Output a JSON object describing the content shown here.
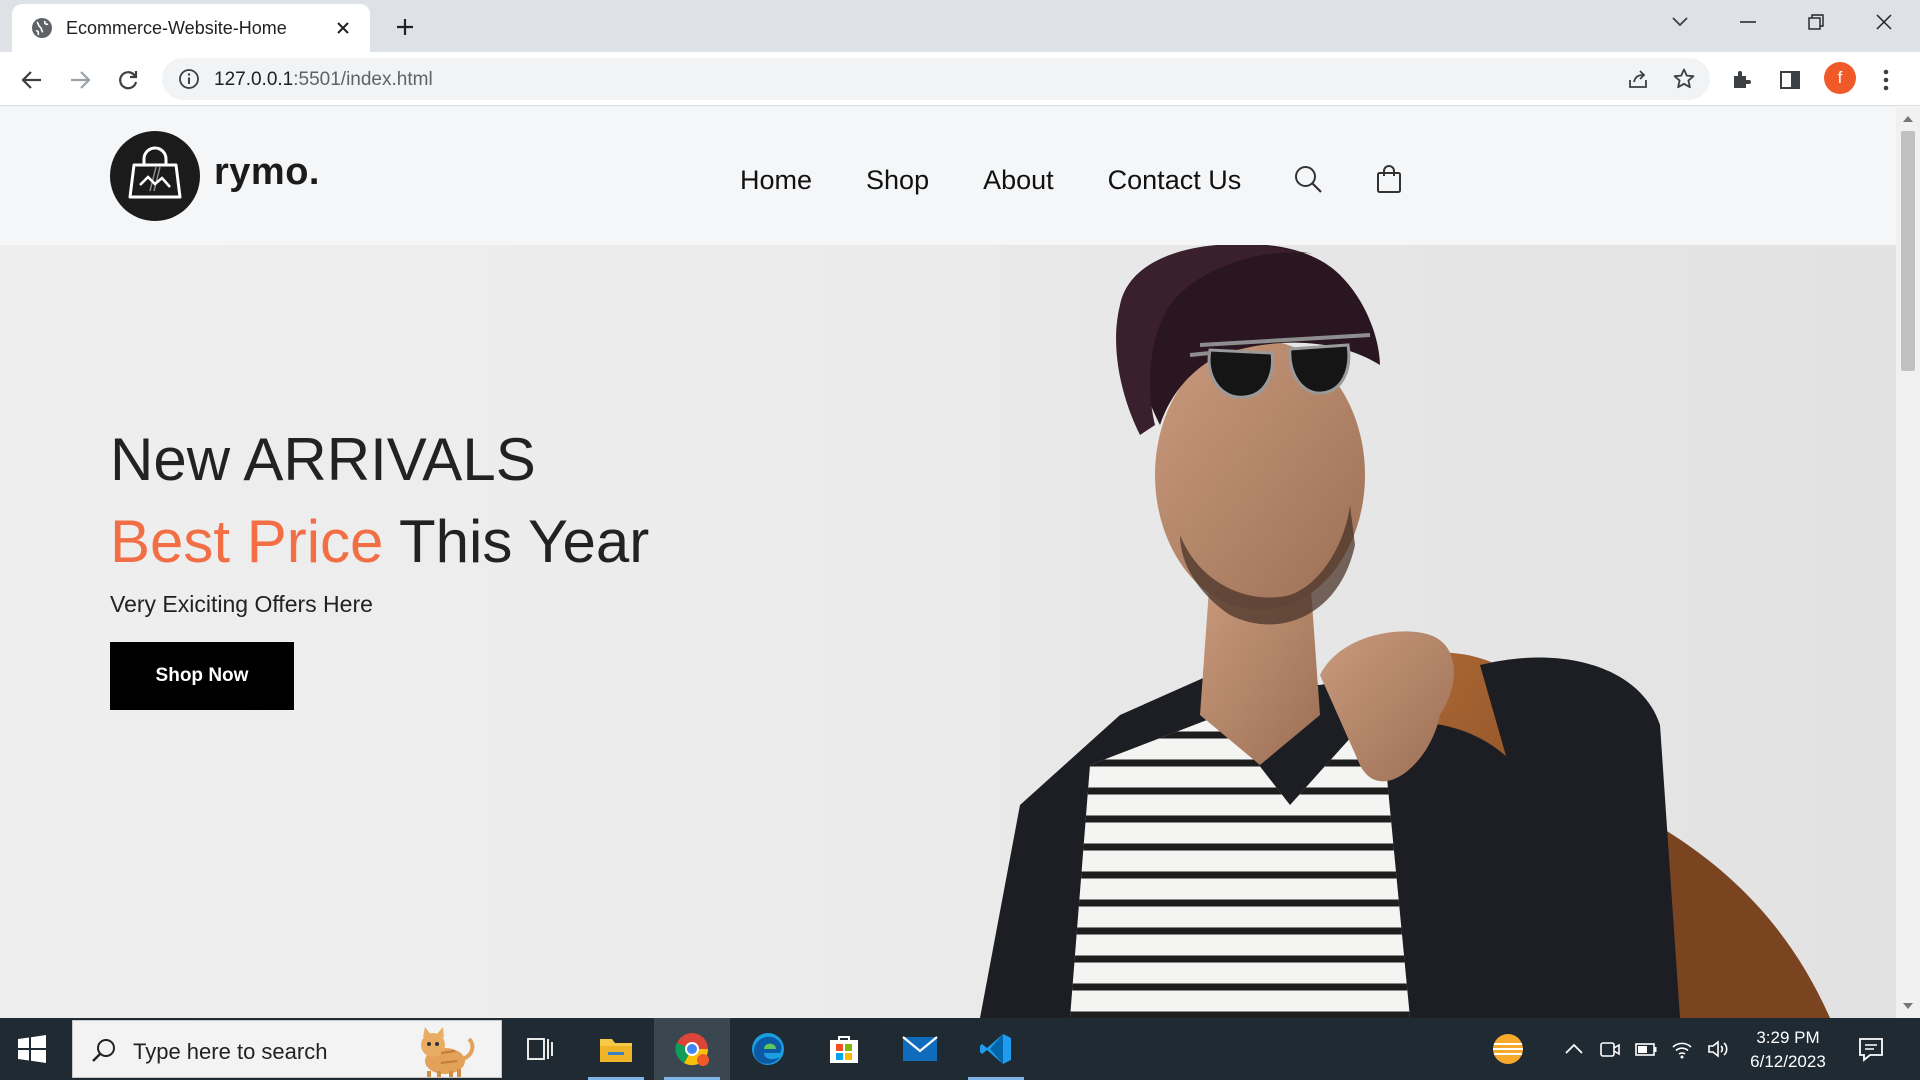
{
  "browser": {
    "tab_title": "Ecommerce-Website-Home",
    "url_host": "127.0.0.1",
    "url_rest": ":5501/index.html",
    "profile_initial": "f",
    "profile_color": "#f05a28"
  },
  "site": {
    "logo_text": "rymo.",
    "nav": [
      "Home",
      "Shop",
      "About",
      "Contact Us"
    ],
    "icons": [
      "search-icon",
      "shopping-bag-icon"
    ]
  },
  "hero": {
    "line1": "New ARRIVALS",
    "line2_accent": "Best Price",
    "line2_rest": "This Year",
    "subtitle": "Very Exiciting Offers Here",
    "button": "Shop Now",
    "accent_color": "#f26f46"
  },
  "taskbar": {
    "search_placeholder": "Type here to search",
    "apps": [
      "task-view-icon",
      "file-explorer-icon",
      "chrome-icon",
      "edge-icon",
      "microsoft-store-icon",
      "mail-icon",
      "vscode-icon"
    ],
    "time": "3:29 PM",
    "date": "6/12/2023"
  }
}
